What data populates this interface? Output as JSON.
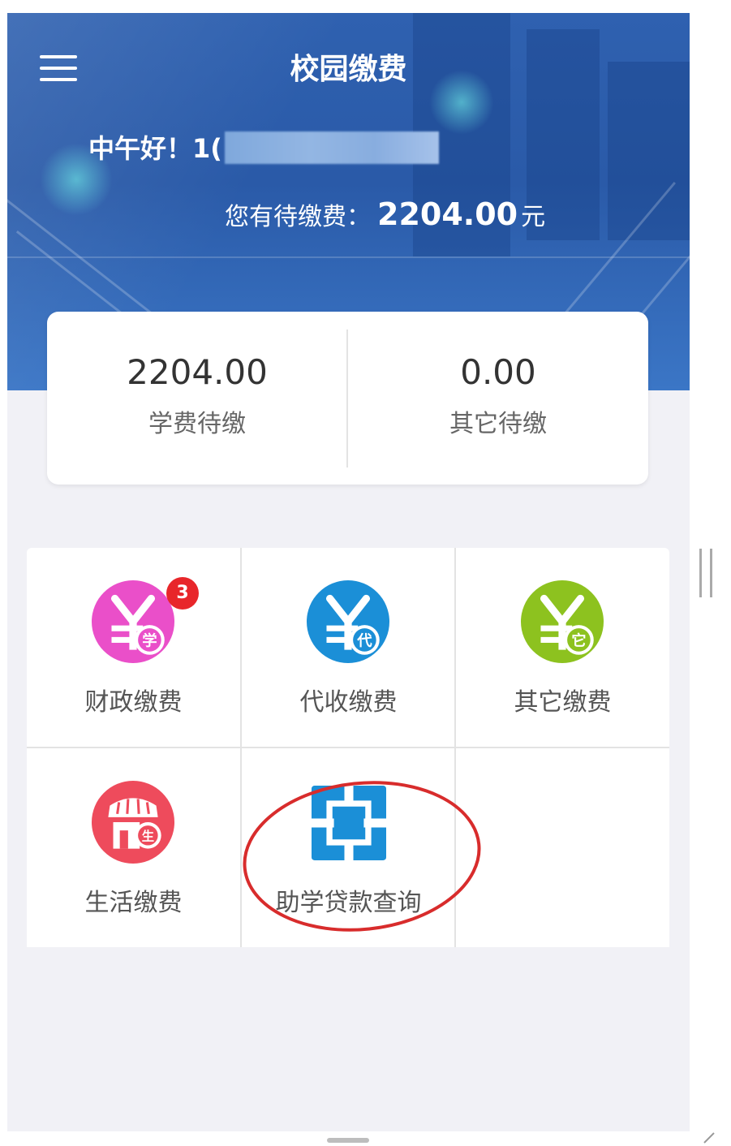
{
  "header": {
    "title": "校园缴费",
    "greeting": "中午好！1(",
    "due_label": "您有待缴费：",
    "due_amount": "2204.00",
    "due_unit": "元"
  },
  "summary": [
    {
      "value": "2204.00",
      "label": "学费待缴"
    },
    {
      "value": "0.00",
      "label": "其它待缴"
    }
  ],
  "services": [
    {
      "label": "财政缴费",
      "icon": "yen-study-icon",
      "icon_char": "学",
      "badge": "3",
      "color": "#ea4fc9"
    },
    {
      "label": "代收缴费",
      "icon": "yen-collect-icon",
      "icon_char": "代",
      "color": "#1b8fd7"
    },
    {
      "label": "其它缴费",
      "icon": "yen-other-icon",
      "icon_char": "它",
      "color": "#8dc21f"
    },
    {
      "label": "生活缴费",
      "icon": "shop-life-icon",
      "icon_char": "生",
      "color": "#ee4b5c"
    },
    {
      "label": "助学贷款查询",
      "icon": "loan-square-icon",
      "color": "#1b8fd7",
      "highlighted": true
    }
  ],
  "colors": {
    "header_blue": "#2f61b0",
    "badge_red": "#e8262a",
    "highlight_red": "#d82c2c"
  }
}
